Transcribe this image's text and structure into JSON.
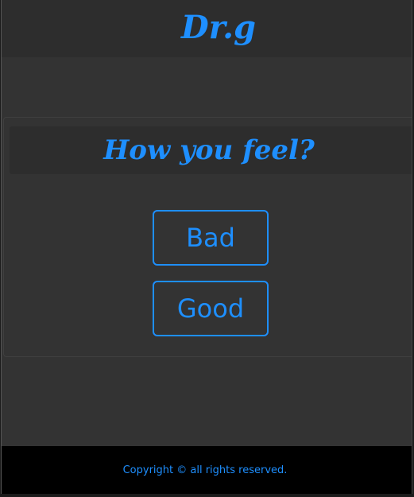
{
  "header": {
    "brand": "Dr.g"
  },
  "card": {
    "title": "How you feel?",
    "buttons": [
      {
        "label": "Bad"
      },
      {
        "label": "Good"
      }
    ]
  },
  "footer": {
    "copyright": "Copyright © all rights reserved."
  },
  "colors": {
    "accent": "#1e8fff",
    "background": "#333333",
    "header_bg": "#2d2d2d",
    "footer_bg": "#000000"
  }
}
